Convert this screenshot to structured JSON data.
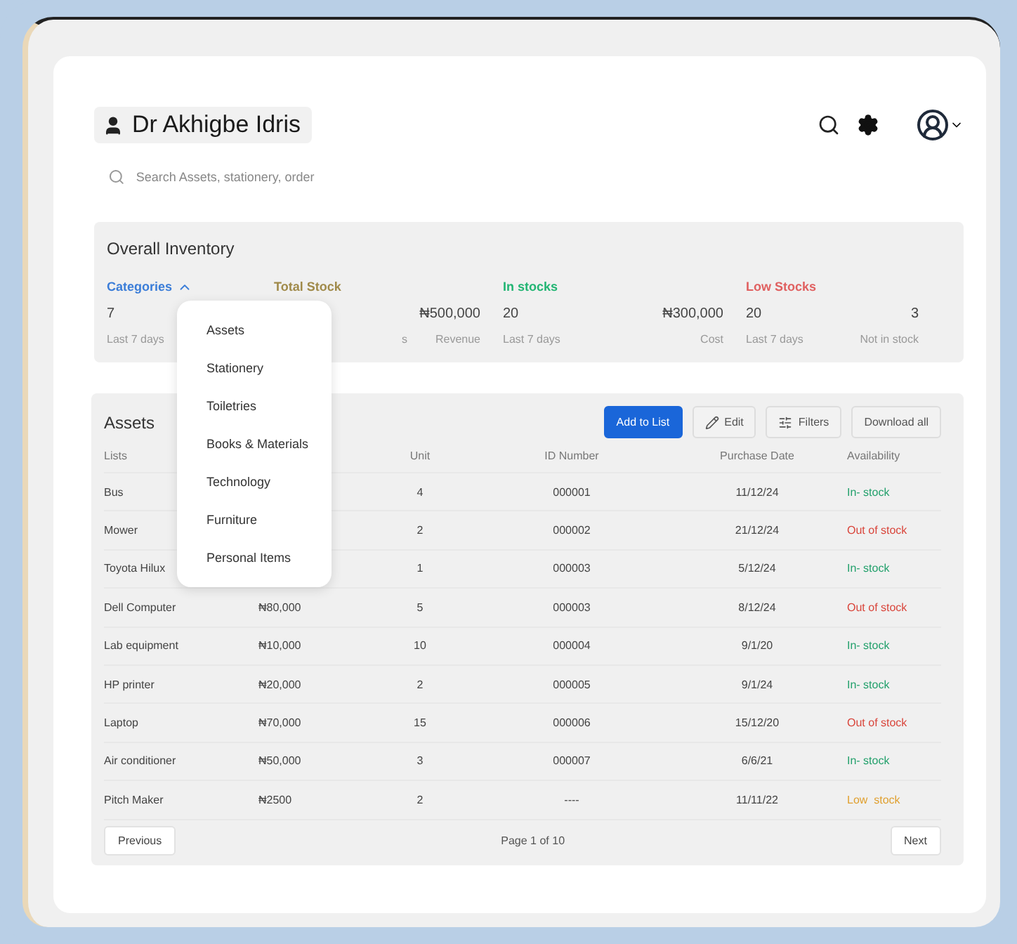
{
  "header": {
    "user_name": "Dr Akhigbe Idris",
    "search": {
      "placeholder": "Search Assets, stationery, order"
    }
  },
  "inventory": {
    "title": "Overall Inventory",
    "kpis": [
      {
        "title": "Categories",
        "color": "#3b7dd8",
        "expanded": true,
        "left_value": "7",
        "left_caption": "Last 7 days"
      },
      {
        "title": "Total Stock",
        "color": "#a08a4a",
        "left_caption": "s",
        "right_value": "₦500,000",
        "right_caption": "Revenue"
      },
      {
        "title": "In stocks",
        "color": "#22b573",
        "left_value": "20",
        "left_caption": "Last 7 days",
        "right_value": "₦300,000",
        "right_caption": "Cost"
      },
      {
        "title": "Low Stocks",
        "color": "#e06060",
        "left_value": "20",
        "left_caption": "Last 7 days",
        "right_value": "3",
        "right_caption": "Not in stock"
      }
    ]
  },
  "category_menu": [
    "Assets",
    "Stationery",
    "Toiletries",
    "Books & Materials",
    "Technology",
    "Furniture",
    "Personal Items"
  ],
  "assets": {
    "title": "Assets",
    "buttons": [
      {
        "label": "Add to List",
        "kind": "primary"
      },
      {
        "label": "Edit",
        "kind": "edit"
      },
      {
        "label": "Filters",
        "kind": "filter"
      },
      {
        "label": "Download all",
        "kind": "plain"
      }
    ],
    "columns": [
      "Lists",
      "",
      "Unit",
      "ID Number",
      "Purchase Date",
      "Availability"
    ],
    "rows": [
      {
        "name": "Bus",
        "unit": "4",
        "id": "000001",
        "date": "11/12/24",
        "status": "In- stock",
        "color": "#22a06b"
      },
      {
        "name": "Mower",
        "unit": "2",
        "id": "000002",
        "date": "21/12/24",
        "status": "Out of stock",
        "color": "#d9453b"
      },
      {
        "name": "Toyota Hilux",
        "unit": "1",
        "id": "000003",
        "date": "5/12/24",
        "status": "In- stock",
        "color": "#22a06b"
      },
      {
        "name": "Dell Computer",
        "price": "₦80,000",
        "unit": "5",
        "id": "000003",
        "date": "8/12/24",
        "status": "Out of stock",
        "color": "#d9453b"
      },
      {
        "name": "Lab equipment",
        "price": "₦10,000",
        "unit": "10",
        "id": "000004",
        "date": "9/1/20",
        "status": "In- stock",
        "color": "#22a06b"
      },
      {
        "name": "HP printer",
        "price": "₦20,000",
        "unit": "2",
        "id": "000005",
        "date": "9/1/24",
        "status": "In- stock",
        "color": "#22a06b"
      },
      {
        "name": "Laptop",
        "price": "₦70,000",
        "unit": "15",
        "id": "000006",
        "date": "15/12/20",
        "status": "Out of stock",
        "color": "#d9453b"
      },
      {
        "name": "Air conditioner",
        "price": "₦50,000",
        "unit": "3",
        "id": "000007",
        "date": "6/6/21",
        "status": "In- stock",
        "color": "#22a06b"
      },
      {
        "name": "Pitch Maker",
        "price": "₦2500",
        "unit": "2",
        "id": "----",
        "date": "11/11/22",
        "status": "Low  stock",
        "color": "#e0a030"
      }
    ],
    "pagination": {
      "previous": "Previous",
      "page": "Page 1 of 10",
      "next": "Next"
    }
  }
}
